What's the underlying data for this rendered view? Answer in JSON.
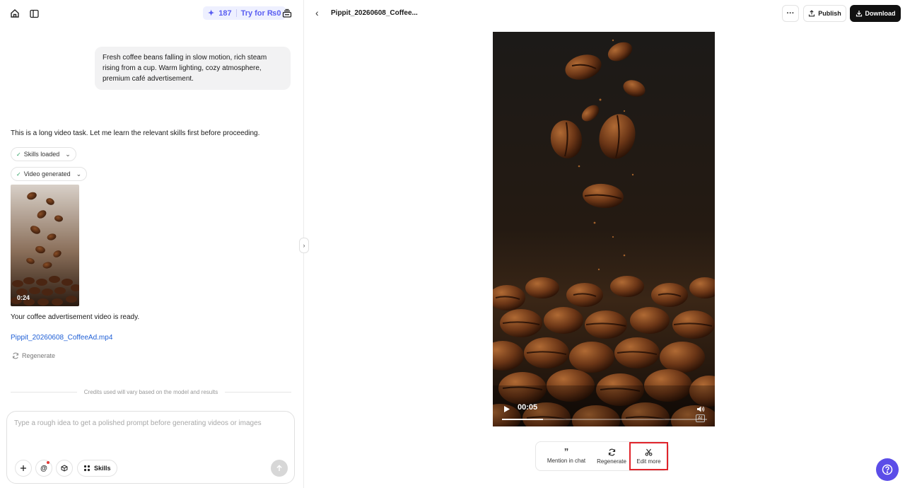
{
  "header": {
    "credits_count": "187",
    "credits_cta": "Try for ₨0"
  },
  "chat": {
    "user_message": "Fresh coffee beans falling in slow motion, rich steam rising from a cup. Warm lighting, cozy atmosphere, premium café advertisement.",
    "assistant_intro": "This is a long video task. Let me learn the relevant skills first before proceeding.",
    "pill_skills": "Skills loaded",
    "pill_video": "Video generated",
    "thumb_duration": "0:24",
    "ready_text": "Your coffee advertisement video is ready.",
    "file_link": "Pippit_20260608_CoffeeAd.mp4",
    "regenerate_label": "Regenerate",
    "credits_note": "Credits used will vary based on the model and results"
  },
  "composer": {
    "placeholder": "Type a rough idea to get a polished prompt before generating videos or images",
    "skills_label": "Skills"
  },
  "preview": {
    "title": "Pippit_20260608_Coffee...",
    "publish_label": "Publish",
    "download_label": "Download",
    "video_time": "00:05",
    "progress": 0.2,
    "ai_badge": "AI"
  },
  "actions": {
    "mention": "Mention in chat",
    "regenerate": "Regenerate",
    "edit_more": "Edit more"
  },
  "colors": {
    "accent": "#5b5ff2",
    "link": "#1f5fd6",
    "highlight": "#e0242b",
    "help": "#5b4de8"
  }
}
